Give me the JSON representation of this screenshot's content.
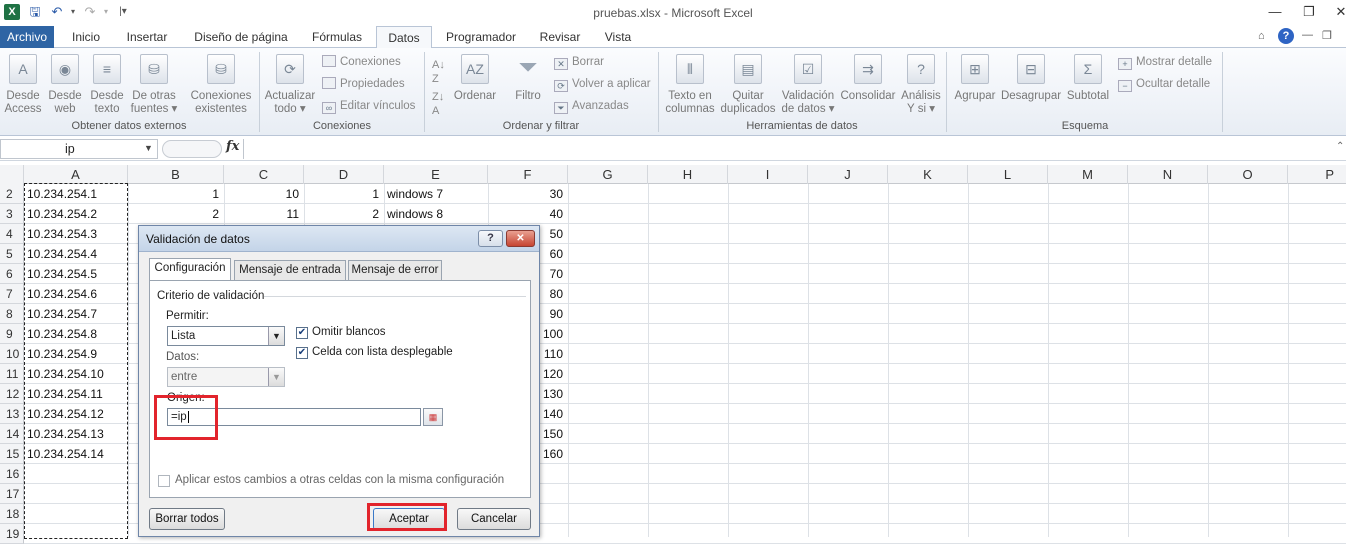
{
  "window": {
    "title": "pruebas.xlsx - Microsoft Excel",
    "controls": [
      "—",
      "❐",
      "✕"
    ]
  },
  "tabs": [
    {
      "label": "Archivo"
    },
    {
      "label": "Inicio"
    },
    {
      "label": "Insertar"
    },
    {
      "label": "Diseño de página"
    },
    {
      "label": "Fórmulas"
    },
    {
      "label": "Datos"
    },
    {
      "label": "Programador"
    },
    {
      "label": "Revisar"
    },
    {
      "label": "Vista"
    }
  ],
  "ribbon": {
    "groups": {
      "obtener": "Obtener datos externos",
      "conexiones": "Conexiones",
      "ordenar": "Ordenar y filtrar",
      "herramientas": "Herramientas de datos",
      "esquema": "Esquema"
    },
    "buttons": {
      "desde_access": [
        "Desde",
        "Access"
      ],
      "desde_web": [
        "Desde",
        "web"
      ],
      "desde_texto": [
        "Desde",
        "texto"
      ],
      "otras_fuentes": [
        "De otras",
        "fuentes ▾"
      ],
      "conexiones_existentes": [
        "Conexiones",
        "existentes"
      ],
      "actualizar": [
        "Actualizar",
        "todo ▾"
      ],
      "ordenar": [
        "Ordenar"
      ],
      "filtro": [
        "Filtro"
      ],
      "texto_columnas": [
        "Texto en",
        "columnas"
      ],
      "quitar_duplicados": [
        "Quitar",
        "duplicados"
      ],
      "validacion": [
        "Validación",
        "de datos ▾"
      ],
      "consolidar": [
        "Consolidar"
      ],
      "analisis": [
        "Análisis",
        "Y si ▾"
      ],
      "agrupar": [
        "Agrupar"
      ],
      "desagrupar": [
        "Desagrupar"
      ],
      "subtotal": [
        "Subtotal"
      ]
    },
    "small": {
      "conexiones": "Conexiones",
      "propiedades": "Propiedades",
      "editar_vinculos": "Editar vínculos",
      "borrar": "Borrar",
      "volver_aplicar": "Volver a aplicar",
      "avanzadas": "Avanzadas",
      "mostrar_detalle": "Mostrar detalle",
      "ocultar_detalle": "Ocultar detalle"
    }
  },
  "formula_bar": {
    "name_box": "ip",
    "fx": "fx",
    "formula": ""
  },
  "columns": [
    "A",
    "B",
    "C",
    "D",
    "E",
    "F",
    "G",
    "H",
    "I",
    "J",
    "K",
    "L",
    "M",
    "N",
    "O",
    "P"
  ],
  "rows": [
    {
      "n": "2",
      "a": "10.234.254.1",
      "b": "1",
      "c": "10",
      "d": "1",
      "e": "windows 7",
      "f": "30"
    },
    {
      "n": "3",
      "a": "10.234.254.2",
      "b": "2",
      "c": "11",
      "d": "2",
      "e": "windows 8",
      "f": "40"
    },
    {
      "n": "4",
      "a": "10.234.254.3",
      "f": "50"
    },
    {
      "n": "5",
      "a": "10.234.254.4",
      "f": "60"
    },
    {
      "n": "6",
      "a": "10.234.254.5",
      "f": "70"
    },
    {
      "n": "7",
      "a": "10.234.254.6",
      "f": "80"
    },
    {
      "n": "8",
      "a": "10.234.254.7",
      "f": "90"
    },
    {
      "n": "9",
      "a": "10.234.254.8",
      "f": "100"
    },
    {
      "n": "10",
      "a": "10.234.254.9",
      "f": "110"
    },
    {
      "n": "11",
      "a": "10.234.254.10",
      "f": "120"
    },
    {
      "n": "12",
      "a": "10.234.254.11",
      "f": "130"
    },
    {
      "n": "13",
      "a": "10.234.254.12",
      "f": "140"
    },
    {
      "n": "14",
      "a": "10.234.254.13",
      "f": "150"
    },
    {
      "n": "15",
      "a": "10.234.254.14",
      "f": "160"
    },
    {
      "n": "16"
    },
    {
      "n": "17"
    },
    {
      "n": "18"
    },
    {
      "n": "19"
    }
  ],
  "dialog": {
    "title": "Validación de datos",
    "help": "?",
    "close": "✕",
    "tabs": [
      "Configuración",
      "Mensaje de entrada",
      "Mensaje de error"
    ],
    "section": "Criterio de validación",
    "permitir_label": "Permitir:",
    "permitir_value": "Lista",
    "datos_label": "Datos:",
    "datos_value": "entre",
    "omitir_blancos": "Omitir blancos",
    "celda_lista": "Celda con lista desplegable",
    "origen_label": "Origen:",
    "origen_value": "=ip",
    "aplicar_cambios": "Aplicar estos cambios a otras celdas con la misma configuración",
    "borrar_todos": "Borrar todos",
    "aceptar": "Aceptar",
    "cancelar": "Cancelar"
  }
}
